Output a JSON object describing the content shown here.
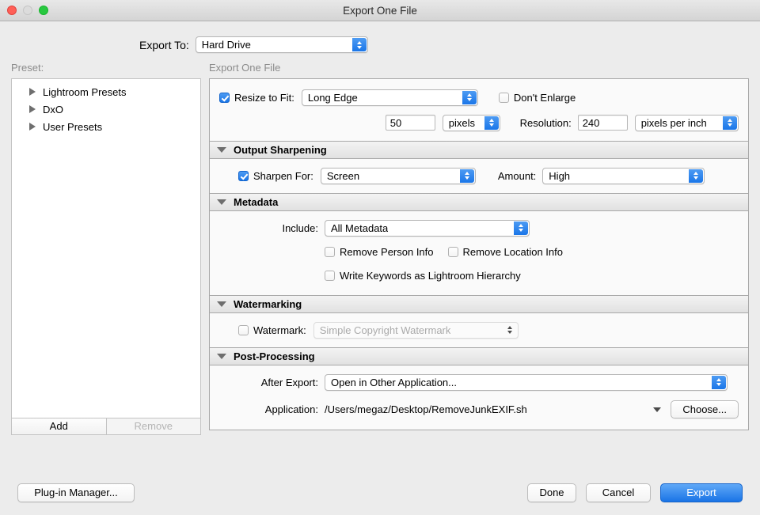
{
  "window": {
    "title": "Export One File",
    "traffic_lights": [
      "close",
      "minimize",
      "zoom"
    ]
  },
  "export_to": {
    "label": "Export To:",
    "value": "Hard Drive"
  },
  "preset_panel": {
    "caption": "Preset:",
    "items": [
      {
        "label": "Lightroom Presets"
      },
      {
        "label": "DxO"
      },
      {
        "label": "User Presets"
      }
    ],
    "add_label": "Add",
    "remove_label": "Remove"
  },
  "right_panel": {
    "caption": "Export One File",
    "image_sizing": {
      "resize_checkbox_label": "Resize to Fit:",
      "resize_checked": true,
      "resize_mode": "Long Edge",
      "dont_enlarge_label": "Don't Enlarge",
      "dont_enlarge_checked": false,
      "size_value": "50",
      "size_unit": "pixels",
      "resolution_label": "Resolution:",
      "resolution_value": "240",
      "resolution_unit": "pixels per inch"
    },
    "output_sharpening": {
      "title": "Output Sharpening",
      "sharpen_checkbox_label": "Sharpen For:",
      "sharpen_checked": true,
      "sharpen_for": "Screen",
      "amount_label": "Amount:",
      "amount_value": "High"
    },
    "metadata": {
      "title": "Metadata",
      "include_label": "Include:",
      "include_value": "All Metadata",
      "remove_person_label": "Remove Person Info",
      "remove_person_checked": false,
      "remove_location_label": "Remove Location Info",
      "remove_location_checked": false,
      "write_keywords_label": "Write Keywords as Lightroom Hierarchy",
      "write_keywords_checked": false
    },
    "watermarking": {
      "title": "Watermarking",
      "watermark_checkbox_label": "Watermark:",
      "watermark_checked": false,
      "watermark_value": "Simple Copyright Watermark"
    },
    "post_processing": {
      "title": "Post-Processing",
      "after_export_label": "After Export:",
      "after_export_value": "Open in Other Application...",
      "application_label": "Application:",
      "application_value": "/Users/megaz/Desktop/RemoveJunkEXIF.sh",
      "choose_label": "Choose..."
    }
  },
  "footer": {
    "plugin_manager_label": "Plug-in Manager...",
    "done_label": "Done",
    "cancel_label": "Cancel",
    "export_label": "Export"
  },
  "colors": {
    "accent_blue": "#1a76e8",
    "traffic_close": "#ff5f57",
    "traffic_min": "#dcdcdc",
    "traffic_max": "#28c840",
    "window_bg": "#ececec"
  }
}
